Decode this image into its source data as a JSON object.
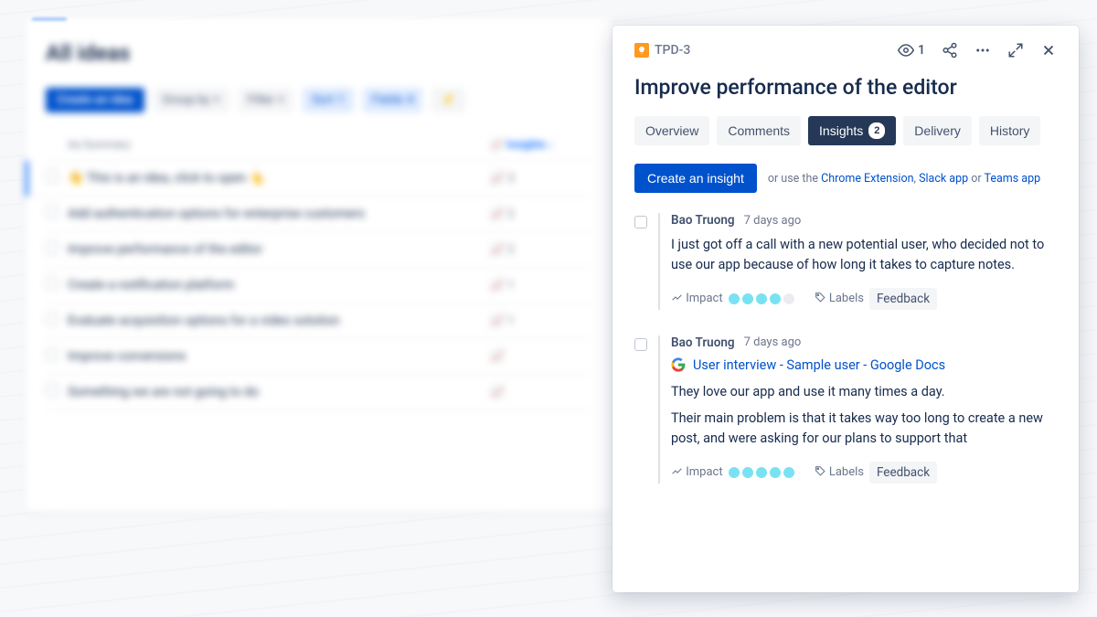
{
  "bg": {
    "title": "All ideas",
    "create": "Create an idea",
    "groupby": "Group by",
    "filter": "Filter",
    "sort": "Sort",
    "sort_badge": "1",
    "fields": "Fields",
    "fields_badge": "4",
    "col_summary": "Aa  Summary",
    "col_insights": "Insights",
    "rows": [
      {
        "text": "👋 This is an idea, click to open 👆",
        "count": "3",
        "sel": true
      },
      {
        "text": "Add authentication options for enterprise customers",
        "count": "2"
      },
      {
        "text": "Improve performance of the editor",
        "count": "2"
      },
      {
        "text": "Create a notification platform",
        "count": "1"
      },
      {
        "text": "Evaluate acquisition options for a video solution",
        "count": "1"
      },
      {
        "text": "Improve conversions",
        "count": ""
      },
      {
        "text": "Something we are not going to do",
        "count": ""
      }
    ]
  },
  "detail": {
    "ticket": "TPD-3",
    "watchers": "1",
    "title": "Improve performance of the editor",
    "tabs": {
      "overview": "Overview",
      "comments": "Comments",
      "insights": "Insights",
      "insights_count": "2",
      "delivery": "Delivery",
      "history": "History"
    },
    "create_insight": "Create an insight",
    "help_prefix": "or use the ",
    "help_links": {
      "chrome": "Chrome Extension",
      "slack": "Slack app",
      "teams": "Teams app"
    },
    "help_sep1": ", ",
    "help_sep2": " or ",
    "impact_label": "Impact",
    "labels_label": "Labels",
    "insights": [
      {
        "author": "Bao Truong",
        "time": "7 days ago",
        "text": "I just got off a call with a new potential user, who decided not to use our app because of how long it takes to capture notes.",
        "impact": 4,
        "labels": [
          "Feedback"
        ]
      },
      {
        "author": "Bao Truong",
        "time": "7 days ago",
        "link_text": "User interview - Sample user - Google Docs",
        "paragraphs": [
          "They love our app and use it many times a day.",
          "Their main problem is that it takes way too long to create a new post, and were asking for our plans to support that"
        ],
        "impact": 5,
        "labels": [
          "Feedback"
        ]
      }
    ]
  }
}
